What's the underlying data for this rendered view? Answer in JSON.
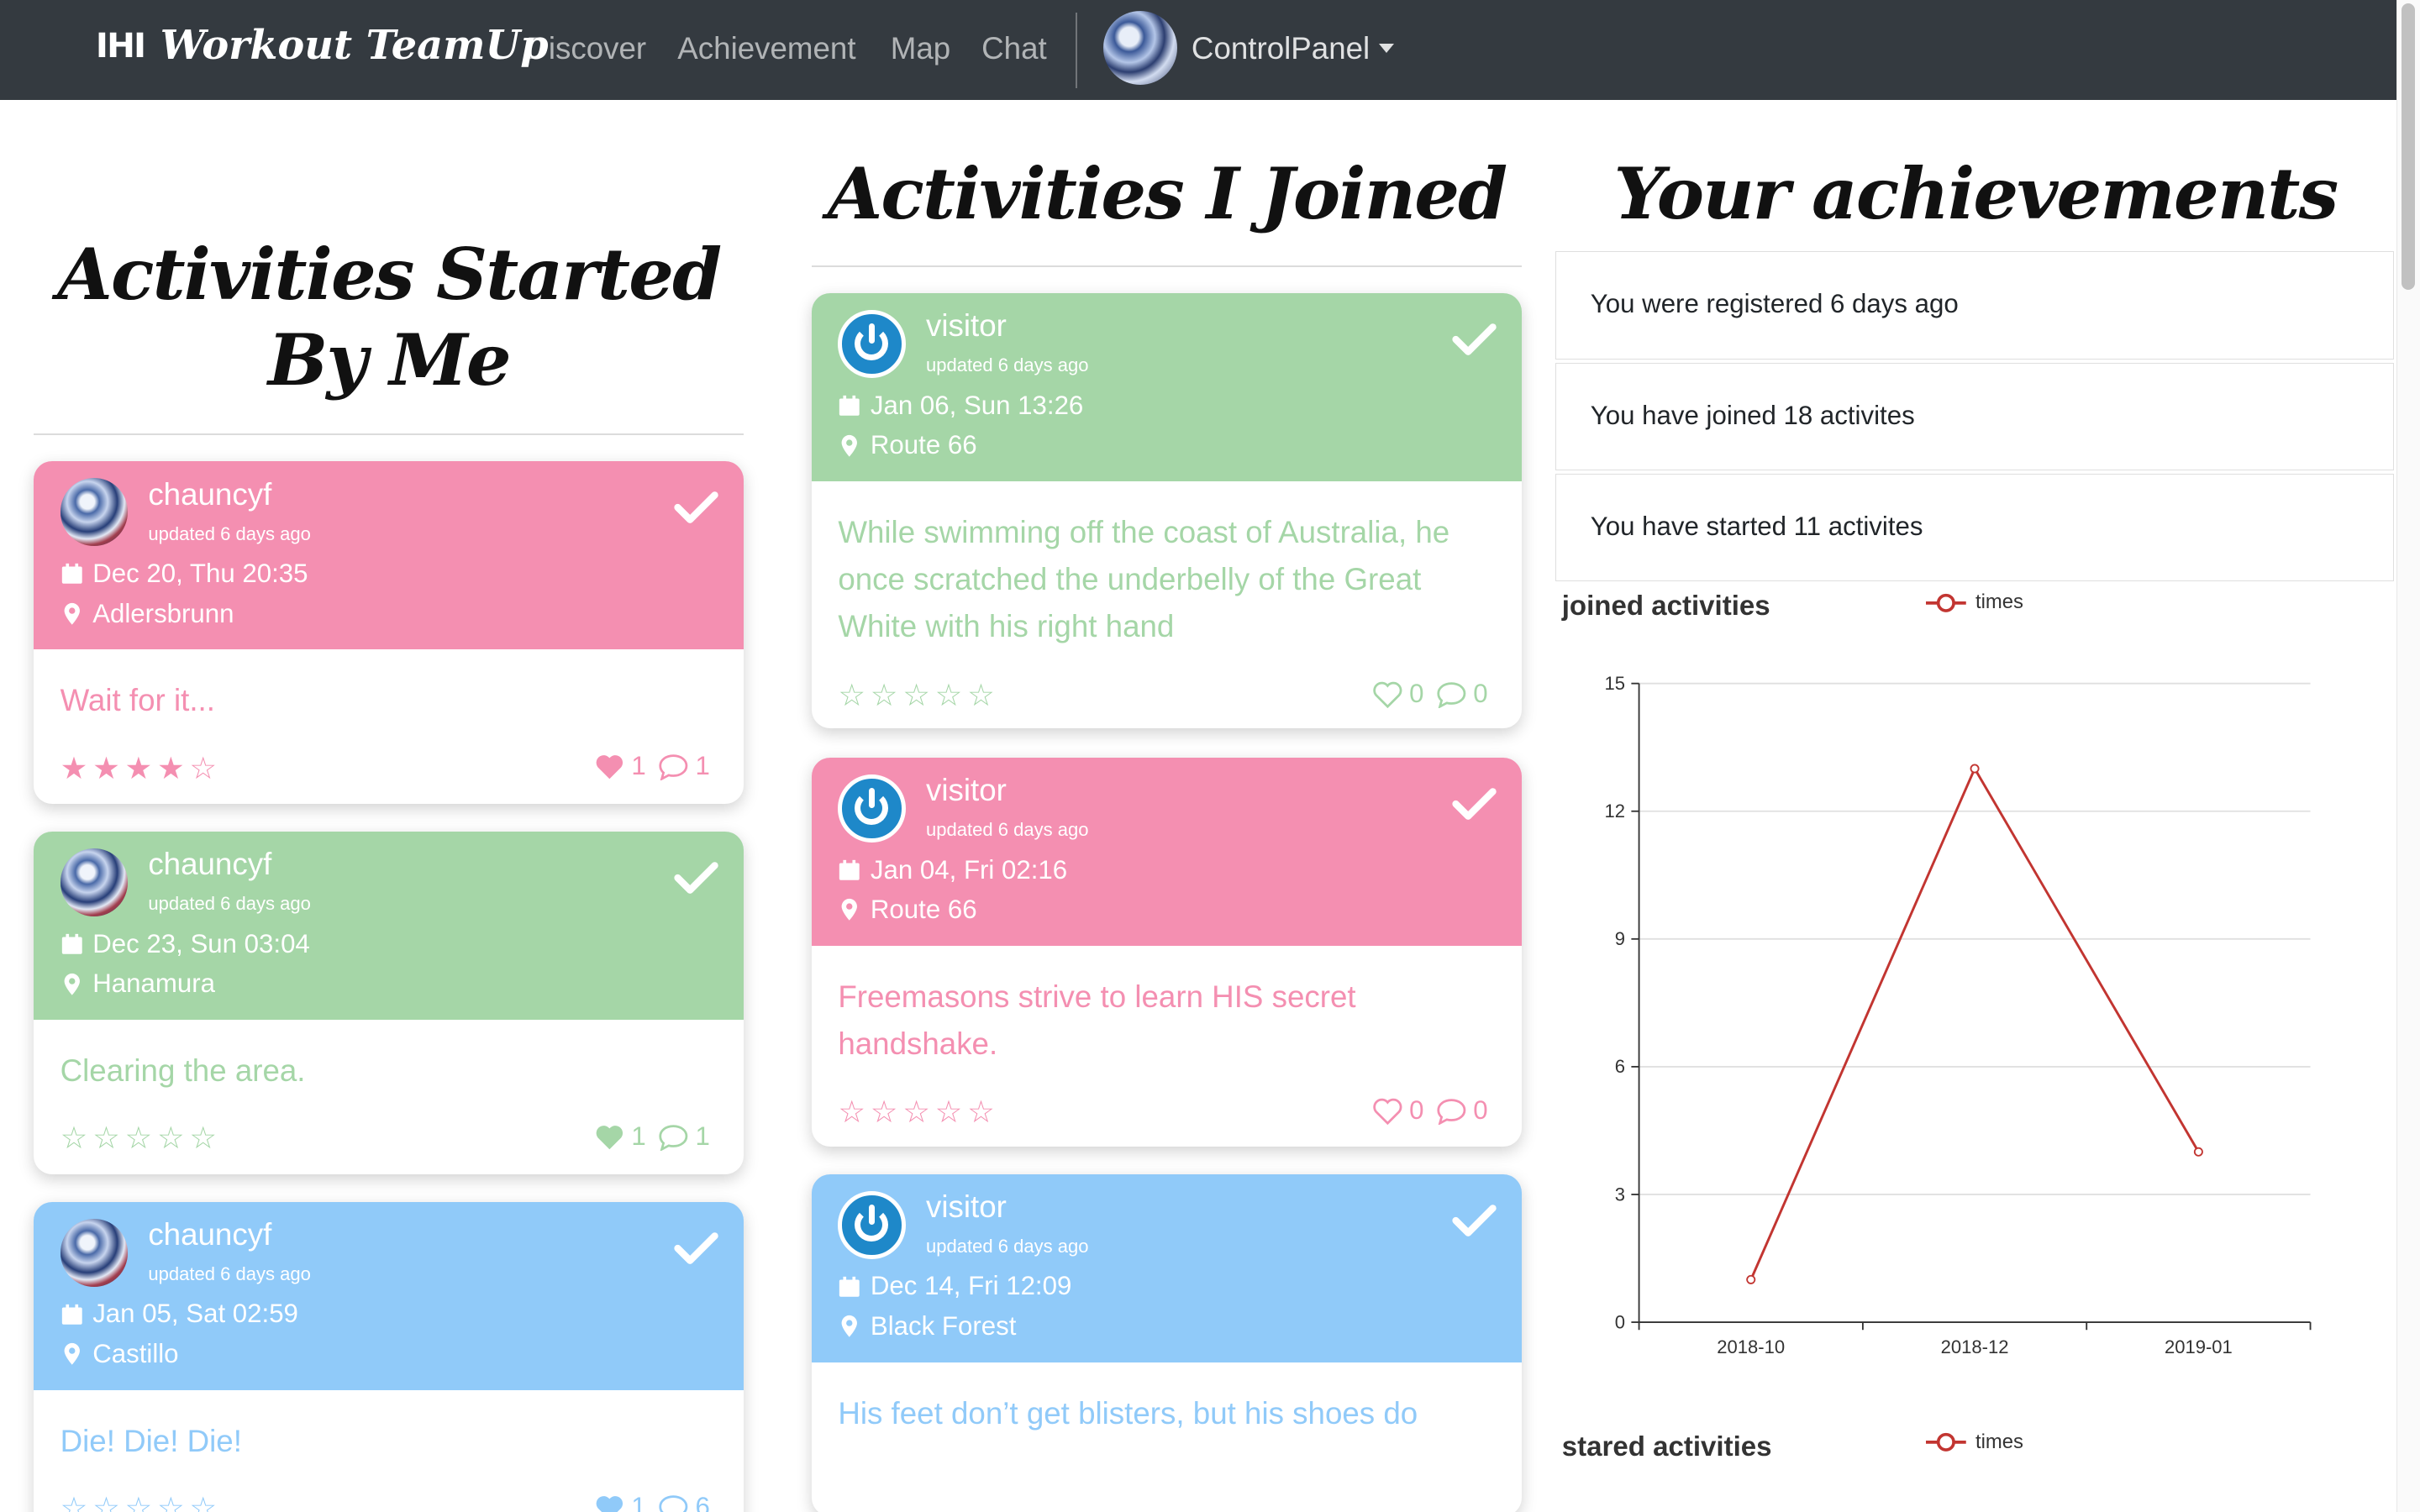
{
  "navbar": {
    "brand": "Workout TeamUp",
    "links": [
      "Discover",
      "Achievement",
      "Map",
      "Chat"
    ],
    "control_panel": "ControlPanel"
  },
  "headings": {
    "started": "Activities Started By Me",
    "joined": "Activities I Joined",
    "achievements": "Your achievements"
  },
  "started_cards": [
    {
      "color": "pink",
      "user": "chauncyf",
      "updated": "updated 6 days ago",
      "date": "Dec 20, Thu 20:35",
      "location": "Adlersbrunn",
      "text": "Wait for it...",
      "rating": 4,
      "likes": "1",
      "comments": "1"
    },
    {
      "color": "green",
      "user": "chauncyf",
      "updated": "updated 6 days ago",
      "date": "Dec 23, Sun 03:04",
      "location": "Hanamura",
      "text": "Clearing the area.",
      "rating": 0,
      "likes": "1",
      "comments": "1"
    },
    {
      "color": "blue",
      "user": "chauncyf",
      "updated": "updated 6 days ago",
      "date": "Jan 05, Sat 02:59",
      "location": "Castillo",
      "text": "Die! Die! Die!",
      "rating": 0,
      "likes": "1",
      "comments": "6"
    }
  ],
  "joined_cards": [
    {
      "color": "green",
      "user": "visitor",
      "updated": "updated 6 days ago",
      "date": "Jan 06, Sun 13:26",
      "location": "Route 66",
      "text": "While swimming off the coast of Australia, he once scratched the underbelly of the Great White with his right hand",
      "rating": 0,
      "likes": "0",
      "comments": "0"
    },
    {
      "color": "pink",
      "user": "visitor",
      "updated": "updated 6 days ago",
      "date": "Jan 04, Fri 02:16",
      "location": "Route 66",
      "text": "Freemasons strive to learn HIS secret handshake.",
      "rating": 0,
      "likes": "0",
      "comments": "0"
    },
    {
      "color": "blue",
      "user": "visitor",
      "updated": "updated 6 days ago",
      "date": "Dec 14, Fri 12:09",
      "location": "Black Forest",
      "text": "His feet don’t get blisters, but his shoes do",
      "rating": 0,
      "likes": "0",
      "comments": "0"
    }
  ],
  "achievements": [
    "You were registered 6 days ago",
    "You have joined 18 activites",
    "You have started 11 activites"
  ],
  "chart_data": [
    {
      "type": "line",
      "title": "joined activities",
      "categories": [
        "2018-10",
        "2018-12",
        "2019-01"
      ],
      "series": [
        {
          "name": "times",
          "values": [
            1,
            13,
            4
          ]
        }
      ],
      "ylim": [
        0,
        15
      ],
      "yticks": [
        0,
        3,
        6,
        9,
        12,
        15
      ],
      "grid": true,
      "legend": "top-center",
      "color": "#c23531"
    },
    {
      "type": "line",
      "title": "stared activities",
      "series": [
        {
          "name": "times",
          "values": []
        }
      ],
      "legend": "top-center",
      "color": "#c23531"
    }
  ]
}
